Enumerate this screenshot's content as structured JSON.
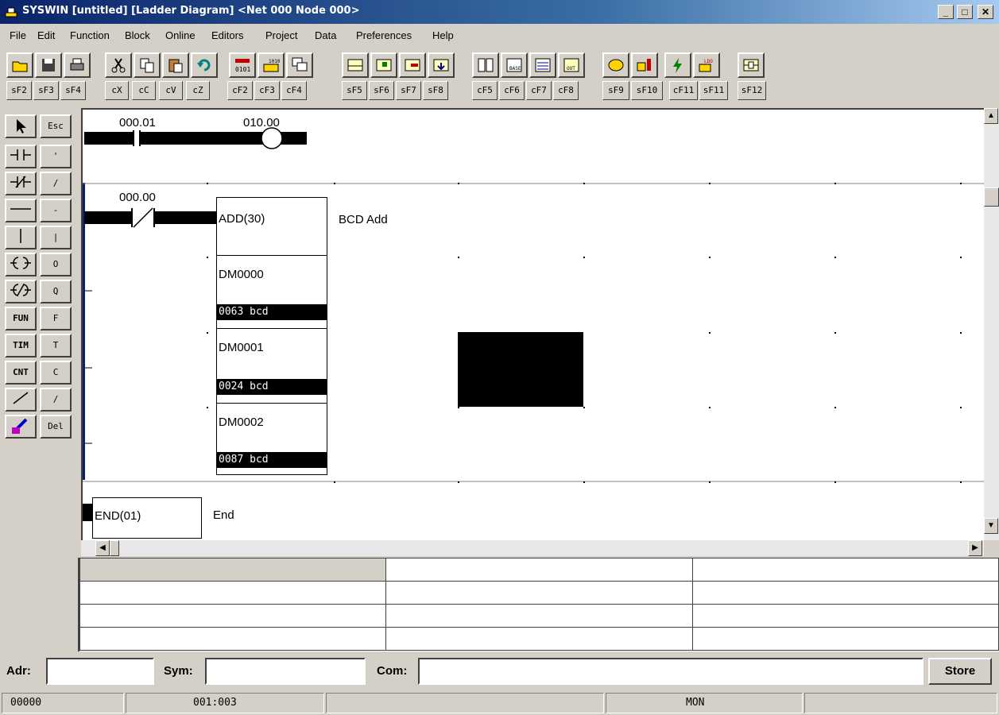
{
  "window": {
    "title": "SYSWIN [untitled] [Ladder Diagram] <Net 000 Node 000>",
    "minimize": "_",
    "maximize": "□",
    "close": "✕"
  },
  "menu": [
    "File",
    "Edit",
    "Function",
    "Block",
    "Online",
    "Editors",
    "Project",
    "Data",
    "Preferences",
    "Help"
  ],
  "toolbar": {
    "icons": [
      "open-icon",
      "save-icon",
      "print-icon",
      "cut-icon",
      "copy-icon",
      "paste-icon",
      "undo-icon",
      "binary-icon",
      "io-table-icon",
      "window-icon",
      "rung-icon",
      "insert-icon",
      "delete-rung-icon",
      "goto-icon",
      "network-icon",
      "database-icon",
      "list-icon",
      "io-icon",
      "phone-icon",
      "transfer-icon",
      "flash-icon",
      "compile-icon",
      "instruction-icon"
    ],
    "shortcuts": [
      "sF2",
      "sF3",
      "sF4",
      "cX",
      "cC",
      "cV",
      "cZ",
      "cF2",
      "cF3",
      "cF4",
      "sF5",
      "sF6",
      "sF7",
      "sF8",
      "cF5",
      "cF6",
      "cF7",
      "cF8",
      "sF9",
      "sF10",
      "cF11",
      "sF11",
      "sF12"
    ]
  },
  "palette": {
    "left": [
      "select-arrow",
      "contact-no",
      "contact-nc",
      "hline",
      "vline",
      "coil",
      "coil-negated",
      "FUN",
      "TIM",
      "CNT",
      "diagonal",
      "edit-tool"
    ],
    "right": [
      "Esc",
      "'",
      "/",
      "-",
      "|",
      "O",
      "Q",
      "F",
      "T",
      "C",
      "/",
      "Del"
    ],
    "labels": {
      "fun": "FUN",
      "tim": "TIM",
      "cnt": "CNT"
    }
  },
  "ladder": {
    "rung0": {
      "contact": "000.01",
      "coil": "010.00"
    },
    "rung1": {
      "contact": "000.00",
      "instruction": "ADD(30)",
      "comment": "BCD Add",
      "operands": [
        {
          "addr": "DM0000",
          "value": "0063 bcd"
        },
        {
          "addr": "DM0001",
          "value": "0024 bcd"
        },
        {
          "addr": "DM0002",
          "value": "0087 bcd"
        }
      ]
    },
    "rung2": {
      "instruction": "END(01)",
      "comment": "End"
    }
  },
  "grid": {
    "rows": [
      [
        "",
        "",
        ""
      ],
      [
        "",
        "",
        ""
      ],
      [
        "",
        "",
        ""
      ],
      [
        "",
        "",
        ""
      ]
    ]
  },
  "inputbar": {
    "adr_label": "Adr:",
    "sym_label": "Sym:",
    "com_label": "Com:",
    "adr_value": "",
    "sym_value": "",
    "com_value": "",
    "store": "Store"
  },
  "status": {
    "address": "00000",
    "position": "001:003",
    "mode": "MON"
  }
}
